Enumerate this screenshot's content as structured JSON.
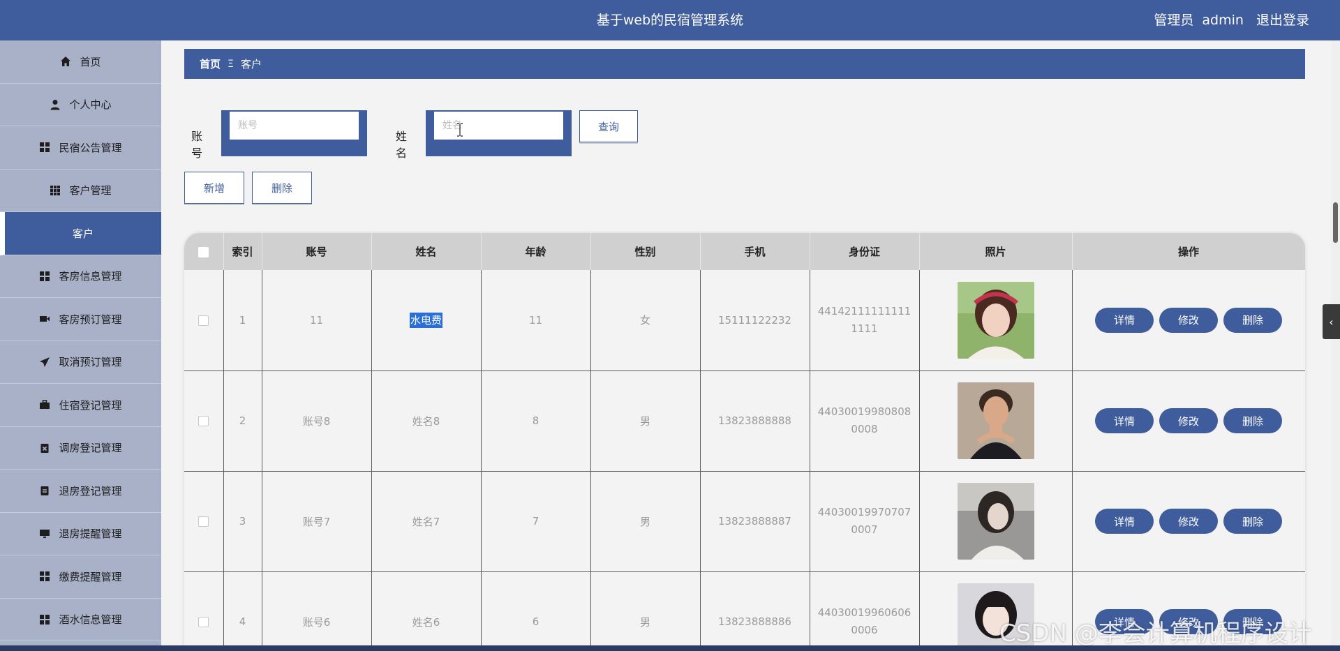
{
  "header": {
    "title": "基于web的民宿管理系统",
    "role": "管理员",
    "username": "admin",
    "logout": "退出登录"
  },
  "sidebar": {
    "items": [
      {
        "label": "首页",
        "icon": "home-icon"
      },
      {
        "label": "个人中心",
        "icon": "user-icon"
      },
      {
        "label": "民宿公告管理",
        "icon": "grid-icon"
      },
      {
        "label": "客户管理",
        "icon": "grid9-icon"
      },
      {
        "label": "客户",
        "icon": ""
      },
      {
        "label": "客房信息管理",
        "icon": "grid-icon"
      },
      {
        "label": "客房预订管理",
        "icon": "video-icon"
      },
      {
        "label": "取消预订管理",
        "icon": "paper-plane-icon"
      },
      {
        "label": "住宿登记管理",
        "icon": "briefcase-icon"
      },
      {
        "label": "调房登记管理",
        "icon": "clipboard-x-icon"
      },
      {
        "label": "退房登记管理",
        "icon": "clipboard-icon"
      },
      {
        "label": "退房提醒管理",
        "icon": "monitor-icon"
      },
      {
        "label": "缴费提醒管理",
        "icon": "grid-icon"
      },
      {
        "label": "酒水信息管理",
        "icon": "grid-icon"
      }
    ],
    "active_index": 4
  },
  "breadcrumb": {
    "home": "首页",
    "separator": "Ξ",
    "current": "客户"
  },
  "search": {
    "account_label": "账号",
    "account_placeholder": "账号",
    "name_label": "姓名",
    "name_placeholder": "姓名",
    "query_button": "查询"
  },
  "actions": {
    "add": "新增",
    "delete": "删除"
  },
  "table": {
    "columns": [
      "索引",
      "账号",
      "姓名",
      "年龄",
      "性别",
      "手机",
      "身份证",
      "照片",
      "操作"
    ],
    "rows": [
      {
        "index": "1",
        "account": "11",
        "name": "水电费",
        "age": "11",
        "gender": "女",
        "phone": "15111122232",
        "idcard": "441421111111111111"
      },
      {
        "index": "2",
        "account": "账号8",
        "name": "姓名8",
        "age": "8",
        "gender": "男",
        "phone": "13823888888",
        "idcard": "440300199808080008"
      },
      {
        "index": "3",
        "account": "账号7",
        "name": "姓名7",
        "age": "7",
        "gender": "男",
        "phone": "13823888887",
        "idcard": "440300199707070007"
      },
      {
        "index": "4",
        "account": "账号6",
        "name": "姓名6",
        "age": "6",
        "gender": "男",
        "phone": "13823888886",
        "idcard": "440300199606060006"
      }
    ],
    "row_actions": {
      "detail": "详情",
      "edit": "修改",
      "delete": "删除"
    }
  },
  "watermark": "CSDN @李会计算机程序设计",
  "colors": {
    "primary": "#3f5c9c",
    "sidebar_bg": "#a8b1c8",
    "header_cell": "#d0d0d0",
    "selection": "#2a6fd6"
  }
}
